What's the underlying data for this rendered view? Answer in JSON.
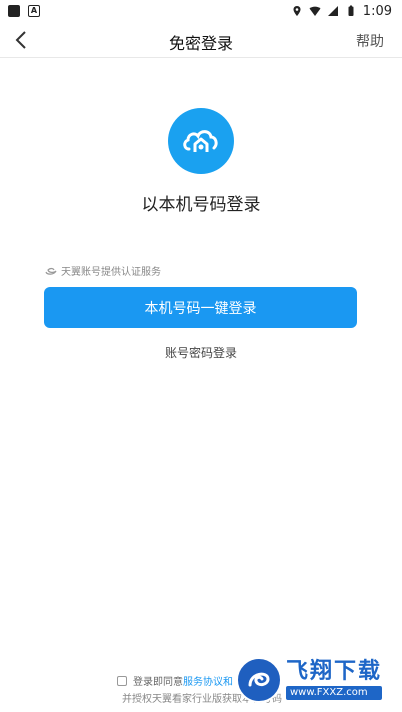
{
  "status_bar": {
    "time": "1:09"
  },
  "header": {
    "title": "免密登录",
    "help_label": "帮助"
  },
  "main": {
    "caption": "以本机号码登录",
    "provider_note": "天翼账号提供认证服务",
    "primary_button": "本机号码一键登录",
    "alt_login": "账号密码登录"
  },
  "footer": {
    "agree_prefix": "登录即同意",
    "agreement_link": "服务协议和",
    "auth_text": "并授权天翼看家行业版获取本机号码"
  },
  "watermark": {
    "name": "飞翔下载",
    "url": "www.FXXZ.com"
  },
  "colors": {
    "primary": "#1a98f2",
    "logo": "#1aa1f0"
  }
}
